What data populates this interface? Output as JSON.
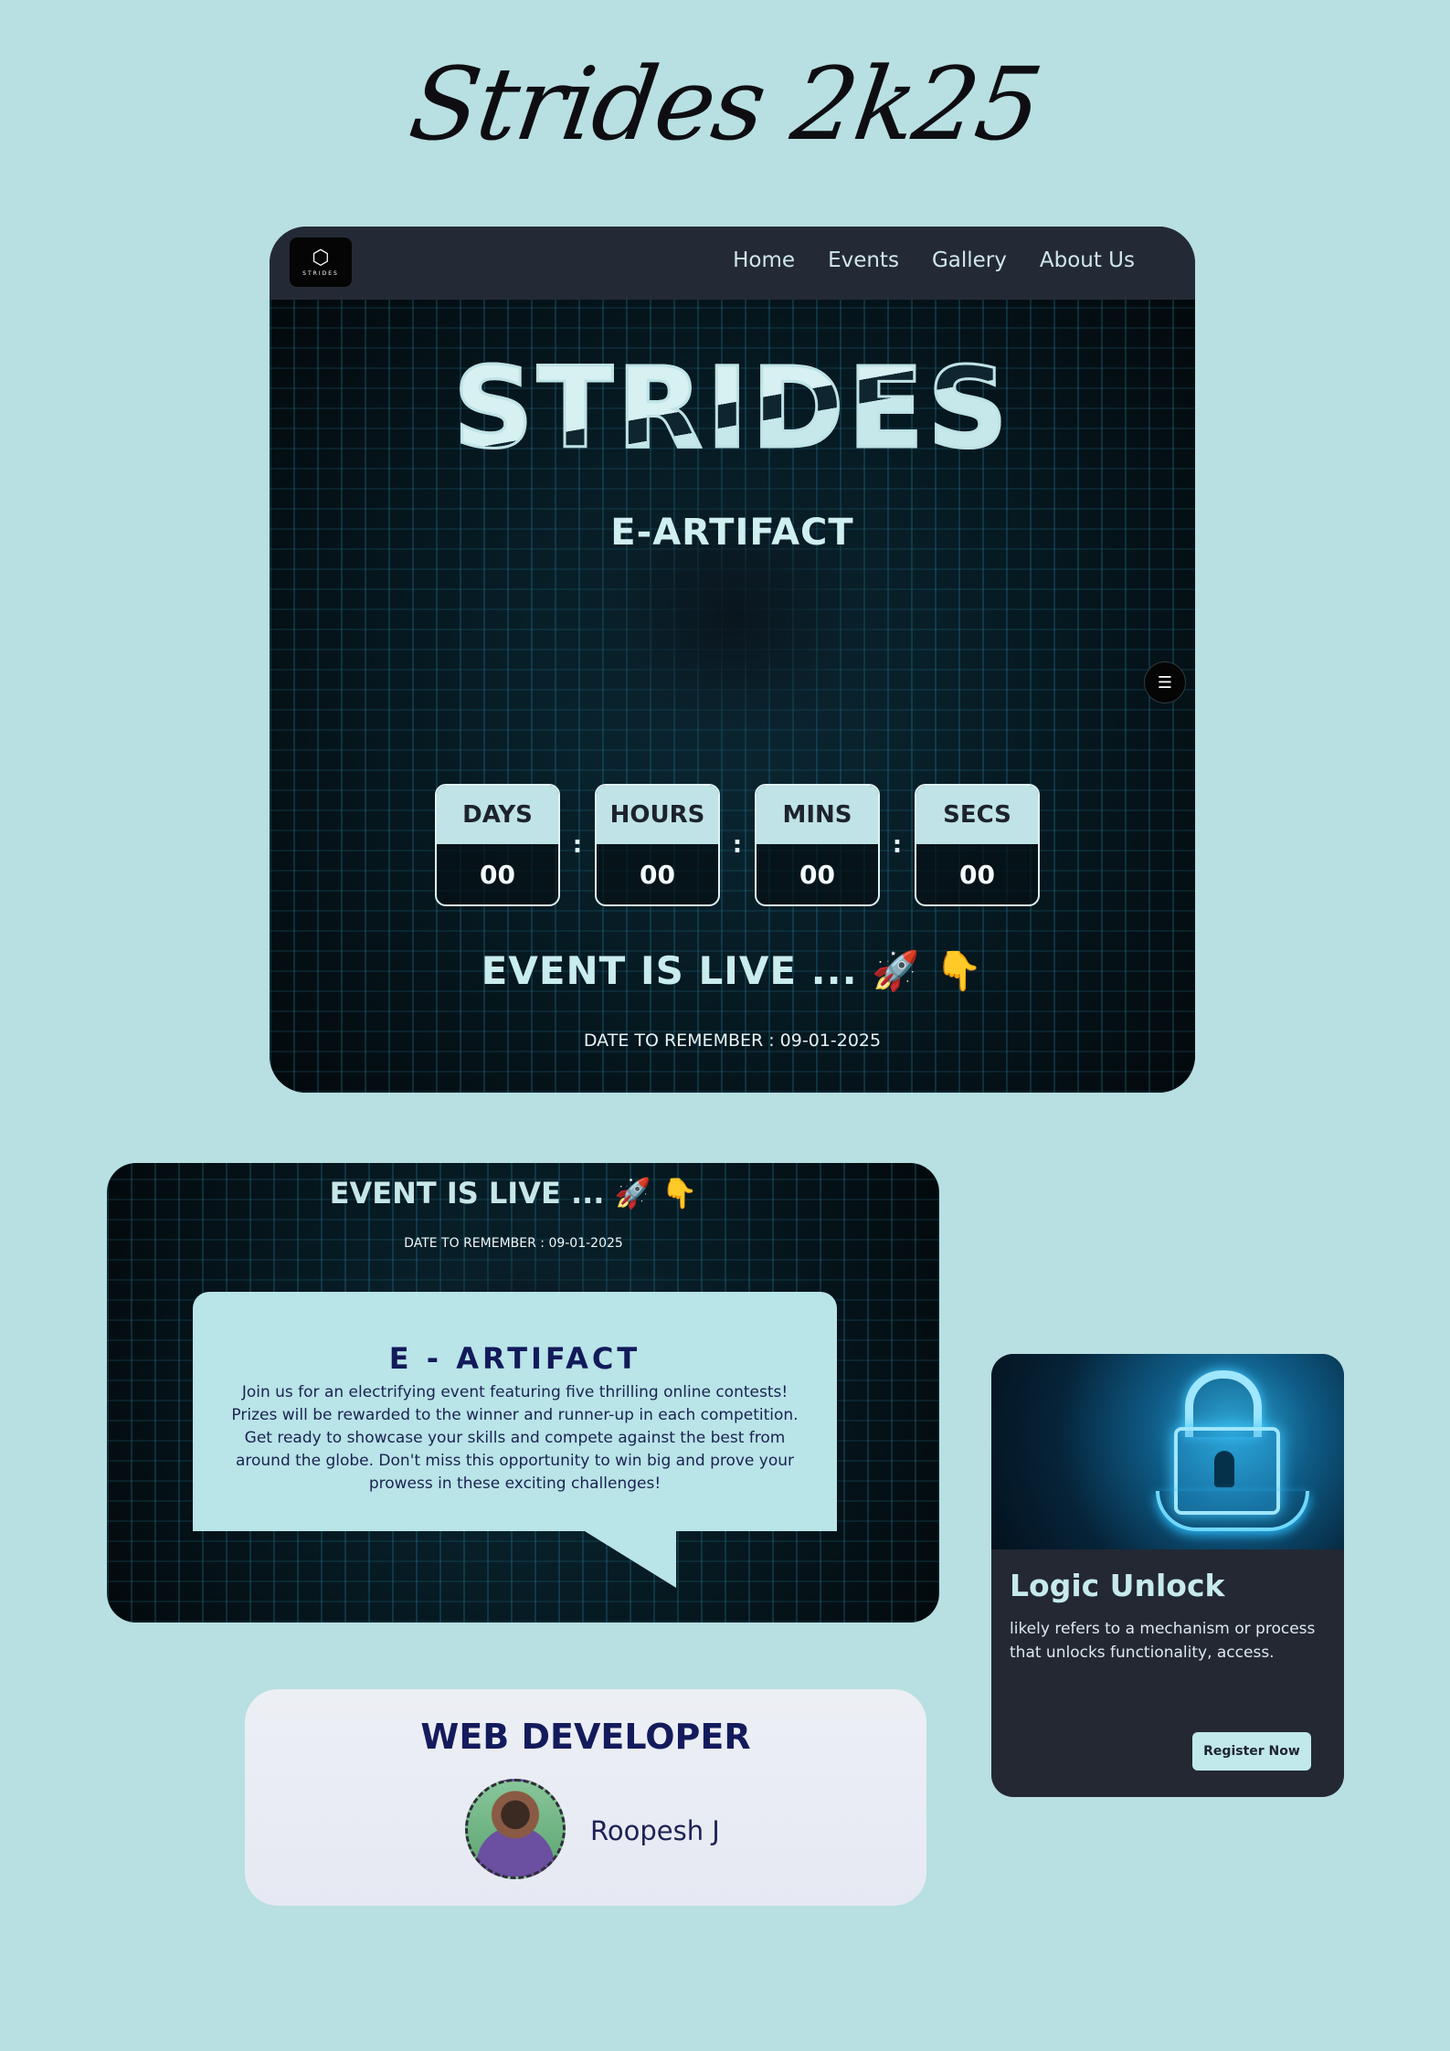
{
  "page": {
    "script_title": "Strides 2k25"
  },
  "hero": {
    "logo_text": "STRIDES",
    "nav": [
      "Home",
      "Events",
      "Gallery",
      "About Us"
    ],
    "title": "STRIDES",
    "subtitle": "E-ARTIFACT",
    "countdown": [
      {
        "label": "DAYS",
        "value": "00"
      },
      {
        "label": "HOURS",
        "value": "00"
      },
      {
        "label": "MINS",
        "value": "00"
      },
      {
        "label": "SECS",
        "value": "00"
      }
    ],
    "separator": ":",
    "live_text": "EVENT IS LIVE ... 🚀 👇",
    "date_text": "DATE TO REMEMBER : 09-01-2025"
  },
  "event_card": {
    "live_text": "EVENT IS LIVE ... 🚀 👇",
    "date_text": "DATE TO REMEMBER : 09-01-2025",
    "heading": "E - ARTIFACT",
    "description": "Join us for an electrifying event featuring five thrilling online contests! Prizes will be rewarded to the winner and runner-up in each competition. Get ready to showcase your skills and compete against the best from around the globe. Don't miss this opportunity to win big and prove your prowess in these exciting challenges!"
  },
  "logic_card": {
    "title": "Logic Unlock",
    "description": "likely refers to a mechanism or process that unlocks functionality, access.",
    "button": "Register Now"
  },
  "developer": {
    "role": "WEB DEVELOPER",
    "name": "Roopesh J"
  }
}
